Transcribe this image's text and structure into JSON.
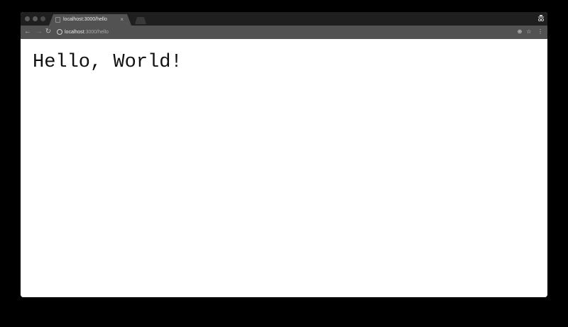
{
  "browser": {
    "tab": {
      "title": "localhost:3000/hello",
      "close_glyph": "×",
      "favicon": "page-icon"
    },
    "profile_icon": "incognito-icon",
    "toolbar": {
      "back_glyph": "←",
      "forward_glyph": "→",
      "reload_glyph": "↻",
      "url_host": "localhost",
      "url_rest": ":3000/hello",
      "zoom_glyph": "⊕",
      "star_glyph": "☆",
      "menu_glyph": "⋮"
    }
  },
  "page": {
    "heading": "Hello, World!"
  },
  "colors": {
    "tabbar_bg": "#1f1f1f",
    "toolbar_bg": "#525252",
    "content_bg": "#ffffff",
    "text": "#111111"
  }
}
